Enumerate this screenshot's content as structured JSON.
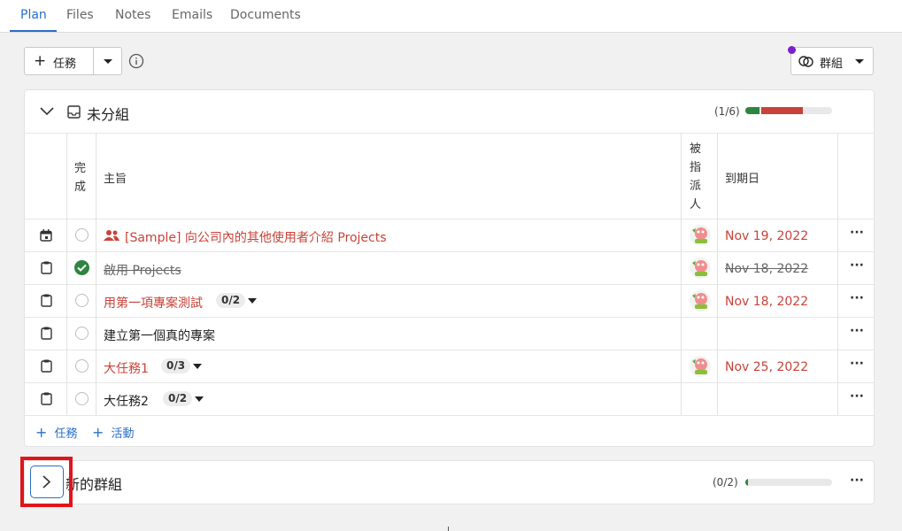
{
  "tabs": [
    {
      "label": "Plan",
      "active": true
    },
    {
      "label": "Files",
      "active": false
    },
    {
      "label": "Notes",
      "active": false
    },
    {
      "label": "Emails",
      "active": false
    },
    {
      "label": "Documents",
      "active": false
    }
  ],
  "toolbar": {
    "add_task_label": "任務",
    "group_label": "群組"
  },
  "group1": {
    "name": "未分組",
    "progress_text": "(1/6)",
    "progress": {
      "done_fraction": 0.1667,
      "overdue_fraction": 0.4833
    },
    "columns": {
      "done": "完成",
      "subject": "主旨",
      "assignee": "被指派人",
      "due": "到期日"
    },
    "rows": [
      {
        "type": "calendar-icon",
        "title": "[Sample] 向公司內的其他使用者介紹 Projects",
        "done": false,
        "overdue": true,
        "has_people": true,
        "subtasks": "",
        "has_assignee": true,
        "due": "Nov 19, 2022"
      },
      {
        "type": "clipboard-icon",
        "title": "啟用 Projects",
        "done": true,
        "overdue": false,
        "has_people": false,
        "subtasks": "",
        "has_assignee": true,
        "due": "Nov 18, 2022"
      },
      {
        "type": "clipboard-icon",
        "title": "用第一項專案測試",
        "done": false,
        "overdue": true,
        "has_people": false,
        "subtasks": "0/2",
        "has_assignee": true,
        "due": "Nov 18, 2022"
      },
      {
        "type": "clipboard-icon",
        "title": "建立第一個真的專案",
        "done": false,
        "overdue": false,
        "has_people": false,
        "subtasks": "",
        "has_assignee": false,
        "due": ""
      },
      {
        "type": "clipboard-icon",
        "title": "大任務1",
        "done": false,
        "overdue": true,
        "has_people": false,
        "subtasks": "0/3",
        "has_assignee": true,
        "due": "Nov 25, 2022"
      },
      {
        "type": "clipboard-icon",
        "title": "大任務2",
        "done": false,
        "overdue": false,
        "has_people": false,
        "subtasks": "0/2",
        "has_assignee": false,
        "due": ""
      }
    ],
    "footer": {
      "add_task": "任務",
      "add_activity": "活動"
    }
  },
  "group2": {
    "name": "新的群組",
    "progress_text": "(0/2)",
    "progress": {
      "done_fraction": 0.03
    }
  },
  "colors": {
    "accent": "#2a6fc9",
    "done": "#2e8540",
    "overdue": "#c94238",
    "notification_dot": "#7b1fd1"
  }
}
